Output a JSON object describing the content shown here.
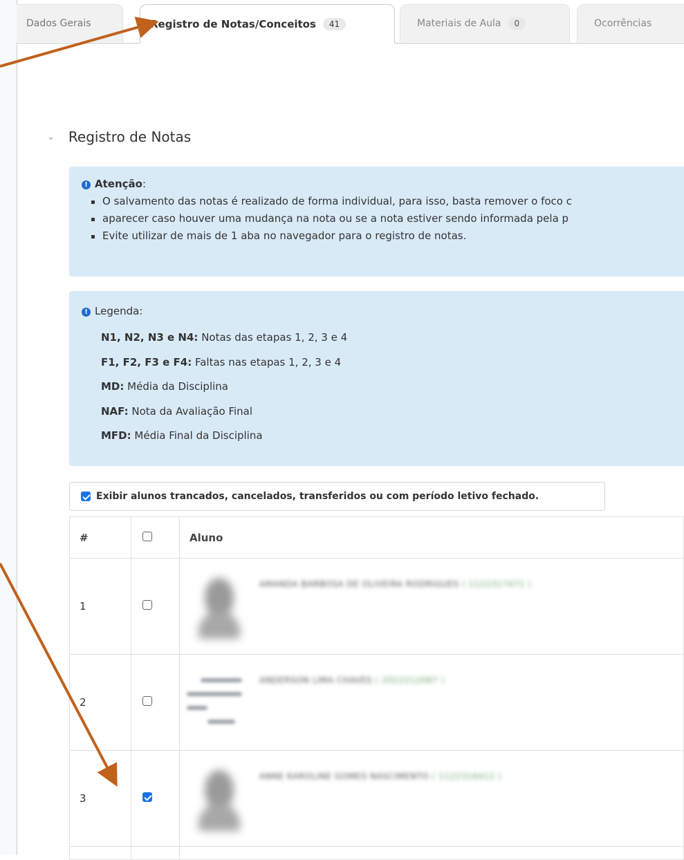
{
  "tabs": [
    {
      "label": "Dados Gerais",
      "badge": null
    },
    {
      "label": "Registro de Notas/Conceitos",
      "badge": "41"
    },
    {
      "label": "Materiais de Aula",
      "badge": "0"
    },
    {
      "label": "Ocorrências",
      "badge": null
    }
  ],
  "section": {
    "title": "Registro de Notas"
  },
  "attention": {
    "title": "Atenção",
    "bullets": [
      "O salvamento das notas é realizado de forma individual, para isso, basta remover o foco c",
      "aparecer caso houver uma mudança na nota ou se a nota estiver sendo informada pela p",
      "Evite utilizar de mais de 1 aba no navegador para o registro de notas."
    ]
  },
  "legend": {
    "title": "Legenda:",
    "items": [
      {
        "key": "N1, N2, N3 e N4:",
        "desc": "Notas das etapas 1, 2, 3 e 4"
      },
      {
        "key": "F1, F2, F3 e F4:",
        "desc": "Faltas nas etapas 1, 2, 3 e 4"
      },
      {
        "key": "MD:",
        "desc": "Média da Disciplina"
      },
      {
        "key": "NAF:",
        "desc": "Nota da Avaliação Final"
      },
      {
        "key": "MFD:",
        "desc": "Média Final da Disciplina"
      }
    ]
  },
  "filter": {
    "label": "Exibir alunos trancados, cancelados, transferidos ou com período letivo fechado.",
    "checked": true
  },
  "table": {
    "headers": {
      "num": "#",
      "aluno": "Aluno"
    },
    "rows": [
      {
        "num": "1",
        "checked": false,
        "name": "AMANDA BARBOSA DE OLIVEIRA RODRIGUES",
        "id": "( 1122317471 )"
      },
      {
        "num": "2",
        "checked": false,
        "name": "ANDERSON LIMA CHAVES",
        "id": "( 2022212087 )"
      },
      {
        "num": "3",
        "checked": true,
        "name": "ANNE KAROLINE GOMES NASCIMENTO",
        "id": "( 1122316412 )"
      }
    ]
  },
  "colors": {
    "accent": "#1a73e8",
    "alert_bg": "#d9eaf7",
    "arrow": "#c0611d"
  }
}
